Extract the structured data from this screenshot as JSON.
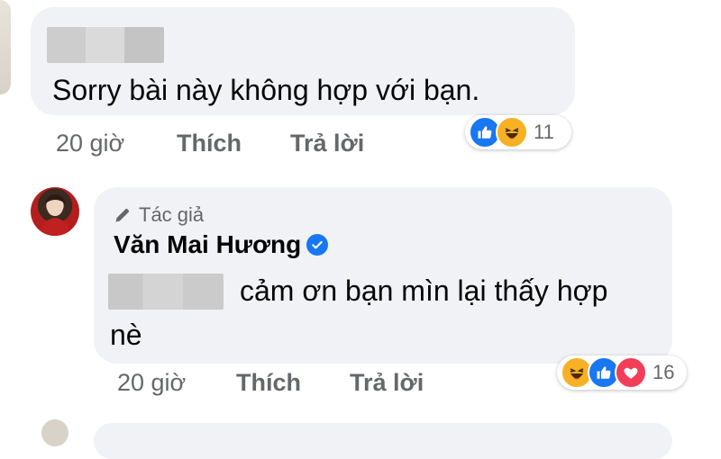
{
  "comment1": {
    "text": "Sorry bài này không hợp với bạn.",
    "time": "20 giờ",
    "like_label": "Thích",
    "reply_label": "Trả lời",
    "reactions": {
      "icons": [
        "like-icon",
        "haha-icon"
      ],
      "count": "11"
    }
  },
  "comment2": {
    "author_badge": "Tác giả",
    "author_name": "Văn Mai Hương",
    "text_line1": "cảm ơn bạn mìn lại thấy hợp",
    "text_line2": "nè",
    "time": "20 giờ",
    "like_label": "Thích",
    "reply_label": "Trả lời",
    "reactions": {
      "icons": [
        "haha-icon",
        "like-icon",
        "love-icon"
      ],
      "count": "16"
    }
  },
  "colors": {
    "bubble": "#f0f2f5",
    "secondary_text": "#65676b",
    "like": "#1877f2",
    "haha": "#f7b125",
    "love": "#f33e58"
  }
}
